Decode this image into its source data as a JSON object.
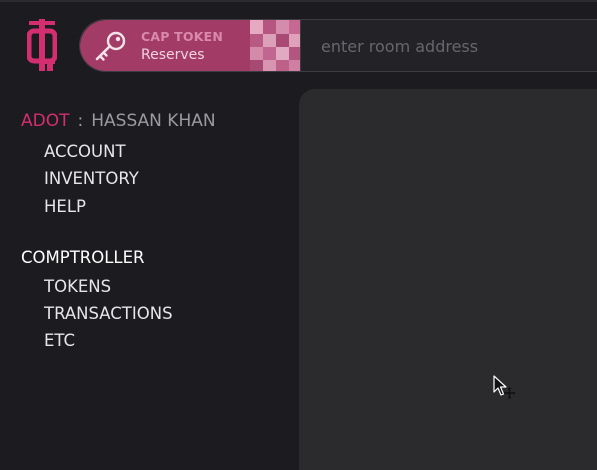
{
  "brand": {
    "logo_icon": "q-logo-icon",
    "accent": "#d22e70"
  },
  "token": {
    "title": "CAP TOKEN",
    "subtitle": "Reserves",
    "icon": "key-icon",
    "pill_color": "#a23b66"
  },
  "address": {
    "placeholder": "enter room address",
    "value": ""
  },
  "user": {
    "prefix": "ADOT",
    "separator": ":",
    "name": "HASSAN KHAN"
  },
  "nav": {
    "account": "ACCOUNT",
    "inventory": "INVENTORY",
    "help": "HELP"
  },
  "comptroller": {
    "heading": "COMPTROLLER",
    "tokens": "TOKENS",
    "transactions": "TRANSACTIONS",
    "etc": "ETC"
  }
}
